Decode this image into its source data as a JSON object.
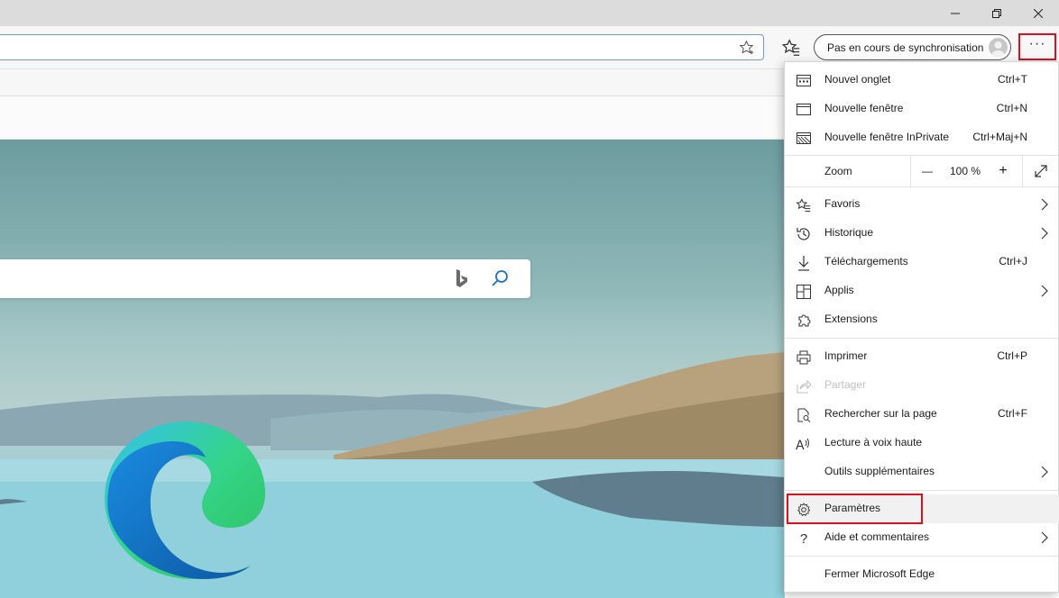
{
  "toolbar": {
    "profile_label": "Pas en cours de synchronisation",
    "menu_dots": "···"
  },
  "menu": {
    "new_tab": {
      "label": "Nouvel onglet",
      "shortcut": "Ctrl+T"
    },
    "new_window": {
      "label": "Nouvelle fenêtre",
      "shortcut": "Ctrl+N"
    },
    "new_private": {
      "label": "Nouvelle fenêtre InPrivate",
      "shortcut": "Ctrl+Maj+N"
    },
    "zoom": {
      "label": "Zoom",
      "minus": "—",
      "value": "100 %",
      "plus": "+"
    },
    "favorites": {
      "label": "Favoris"
    },
    "history": {
      "label": "Historique"
    },
    "downloads": {
      "label": "Téléchargements",
      "shortcut": "Ctrl+J"
    },
    "apps": {
      "label": "Applis"
    },
    "extensions": {
      "label": "Extensions"
    },
    "print": {
      "label": "Imprimer",
      "shortcut": "Ctrl+P"
    },
    "share": {
      "label": "Partager"
    },
    "find": {
      "label": "Rechercher sur la page",
      "shortcut": "Ctrl+F"
    },
    "read_aloud": {
      "label": "Lecture à voix haute"
    },
    "more_tools": {
      "label": "Outils supplémentaires"
    },
    "settings": {
      "label": "Paramètres"
    },
    "help": {
      "label": "Aide et commentaires"
    },
    "close": {
      "label": "Fermer Microsoft Edge"
    }
  },
  "colors": {
    "highlight_border": "#d9121f",
    "address_border": "#6f9bd6"
  }
}
